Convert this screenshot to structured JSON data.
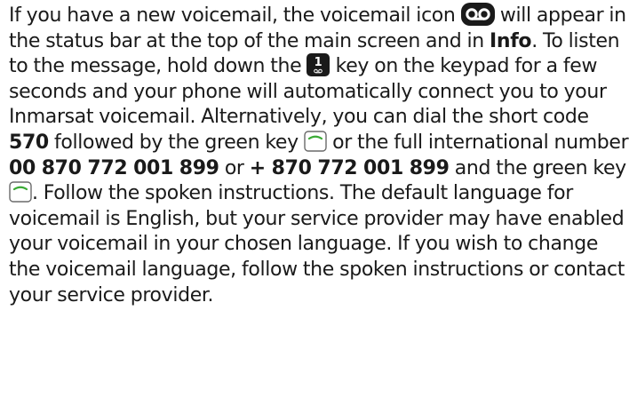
{
  "paragraph": {
    "t1": "If you have a new voicemail, the voicemail icon",
    "t2": "will appear in the status bar at the top of the main screen and in",
    "info": "Info",
    "t3": ". To listen to the message, hold down the",
    "t4": "key on the keypad for a few seconds and your phone will automatically connect you to your Inmarsat voicemail. Alternatively, you can dial the short code",
    "short_code": "570",
    "t5": "followed by the green key",
    "t6": "or the full international number",
    "intl_number": "00 870 772 001 899",
    "t7": "or",
    "plus_number": "+ 870 772 001 899",
    "t8": "and the green key",
    "t9": ". Follow the spoken instructions. The default language for voicemail is English, but your service provider may have enabled your voicemail in your chosen language. If you wish to change the voicemail language, follow the spoken instructions or contact your service provider."
  },
  "icons": {
    "voicemail": "voicemail-icon",
    "key_1": "key-1-icon",
    "key_1_label": "1",
    "green_key": "green-call-key-icon"
  },
  "colors": {
    "text": "#1a1a1a",
    "icon_dark": "#1a1a1a",
    "green_key_line": "#3aaa35"
  }
}
